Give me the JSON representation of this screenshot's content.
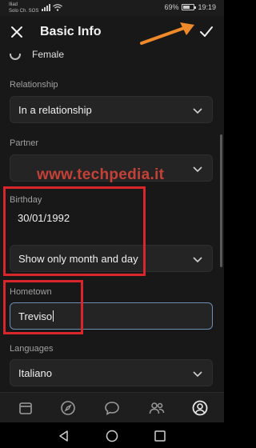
{
  "status_bar": {
    "carrier_line1": "Iliad",
    "carrier_line2": "Solo Ch. SOS",
    "battery_percent": "69%",
    "battery_level": 0.69,
    "time": "19:19"
  },
  "header": {
    "title": "Basic Info",
    "close_icon": "close-icon",
    "save_icon": "check-icon"
  },
  "form": {
    "gender_option": "Female",
    "relationship_label": "Relationship",
    "relationship_value": "In a relationship",
    "partner_label": "Partner",
    "partner_value": "",
    "birthday_label": "Birthday",
    "birthday_value": "30/01/1992",
    "birthday_visibility": "Show only month and day",
    "hometown_label": "Hometown",
    "hometown_value": "Treviso",
    "languages_label": "Languages",
    "languages_value": "Italiano"
  },
  "watermark": "www.techpedia.it",
  "tabs": [
    "calendar-icon",
    "compass-icon",
    "chat-icon",
    "people-icon",
    "profile-icon"
  ],
  "colors": {
    "annotation_red": "#d9262c",
    "annotation_orange": "#f0892a",
    "focus_border": "#6e8fb2"
  }
}
